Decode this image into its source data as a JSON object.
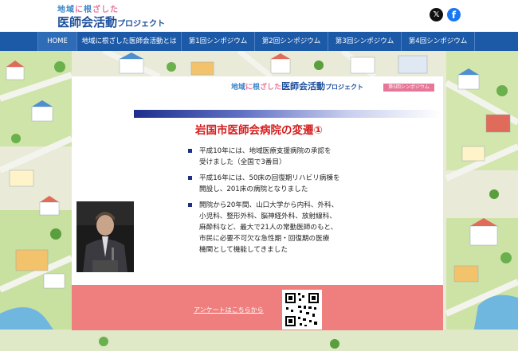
{
  "header": {
    "logo_top_a": "地域",
    "logo_top_b": "に",
    "logo_top_c": "根",
    "logo_top_d": "ざした",
    "logo_main": "医師会活動",
    "logo_sub": "プロジェクト",
    "x_icon": "x-icon",
    "x_glyph": "𝕏",
    "facebook_icon": "facebook-icon",
    "facebook_glyph": "f"
  },
  "nav": {
    "items": [
      {
        "label": "HOME"
      },
      {
        "label": "地域に根ざした医師会活動とは"
      },
      {
        "label": "第1回シンポジウム"
      },
      {
        "label": "第2回シンポジウム"
      },
      {
        "label": "第3回シンポジウム"
      },
      {
        "label": "第4回シンポジウム"
      }
    ]
  },
  "slide": {
    "logo_a": "地域",
    "logo_b": "に",
    "logo_c": "根",
    "logo_d": "ざした",
    "logo_main": "医師会活動",
    "logo_sub": "プロジェクト",
    "badge": "第5回シンポジウム",
    "title": "岩国市医師会病院の変遷①",
    "bullets": [
      {
        "lines": [
          "平成10年には、地域医療支援病院の承認を",
          "受けました（全国で3番目）"
        ]
      },
      {
        "lines": [
          "平成16年には、50床の回復期リハビリ病棟を",
          "開設し、201床の病院となりました"
        ]
      },
      {
        "lines": [
          "開院から20年間、山口大学から内科、外科、",
          "小児科、整形外科、脳神経外科、放射線科、",
          "麻酔科など、最大で21人の常勤医師のもと、",
          "市民に必要不可欠な急性期・回復期の医療",
          "機関として機能してきました"
        ]
      }
    ]
  },
  "survey": {
    "link_label": "アンケートはこちらから"
  },
  "colors": {
    "nav_bg": "#1c5aa8",
    "title_red": "#d41d1d",
    "survey_pink": "#ef7e7e",
    "brand_blue": "#1d4f9c"
  }
}
